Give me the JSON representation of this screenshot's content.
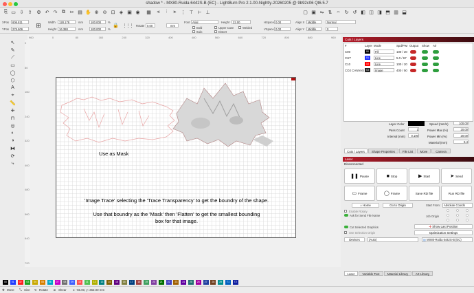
{
  "window": {
    "title": "shadow * - MX80-Ruida 6442S-B (EC) - LightBurn Pro 2.1.00-Nightly-20260205 @ 9b92c06 Qt6.5.7"
  },
  "toolbar2": {
    "xpos_label": "XPos",
    "xpos": "606.811",
    "ypos_label": "YPos",
    "ypos": "276.606",
    "width_label": "Width",
    "width": "128.178",
    "height_label": "Height",
    "height": "16.388",
    "scale_x": "100.000",
    "scale_y": "100.000",
    "unit_mm": "mm",
    "pct": "%",
    "rotate_label": "Rotate",
    "rotate": "0.00",
    "rotate_unit": "mm",
    "font_label": "Font",
    "font": "Arial",
    "height2_label": "Height",
    "text_height": "22.00",
    "hspace_label": "HSpace",
    "hspace": "0.00",
    "vspace_label": "VSpace",
    "vspace": "0.00",
    "align_x_label": "Align X",
    "align_x": "Middle",
    "align_y_label": "Align Y",
    "align_y": "Middle",
    "normal": "Normal",
    "offset": "0",
    "bold": "Bold",
    "italic": "Italic",
    "upper_case": "Upper Case",
    "welded": "Welded",
    "distort": "Distort"
  },
  "rulers": {
    "top": [
      "960",
      "0",
      "80",
      "160",
      "240",
      "320",
      "400",
      "480",
      "560",
      "640",
      "720",
      "800",
      "880",
      "960"
    ],
    "left": [
      "0",
      "80",
      "160",
      "240",
      "320",
      "400",
      "480",
      "560",
      "640",
      "720"
    ]
  },
  "canvas": {
    "note1": "Use as Mask",
    "note2": "'Image Trace' selecting the 'Trace Transparency' to get the boundry of the shape.",
    "note3a": "Use that boundry as the 'Mask' then 'Flatten' to get the smallest bounding",
    "note3b": "box for that image."
  },
  "cuts": {
    "header": "Cuts / Layers",
    "cols": [
      "#",
      "Layer",
      "Mode",
      "Spd/Pwr",
      "Output",
      "Show",
      "Air"
    ],
    "rows": [
      {
        "name": "C00",
        "layer": "00",
        "mode": "Fill",
        "spd": "100 / 20",
        "color": "#000000"
      },
      {
        "name": "CUT",
        "layer": "01",
        "mode": "Line",
        "spd": "5.0 / 67",
        "color": "#2233ff"
      },
      {
        "name": "C10",
        "layer": "10",
        "mode": "Line",
        "spd": "100 / 20",
        "color": "#ff0000"
      },
      {
        "name": "CO2 CANVAS",
        "layer": "T2",
        "mode": "Image",
        "spd": "400 / 50",
        "color": "#222222"
      }
    ],
    "layer_color": "Layer Color",
    "speed_label": "Speed (mm/s)",
    "speed": "100.00",
    "pass_label": "Pass Count",
    "pass": "1",
    "pmax_label": "Power Max (%)",
    "pmax": "20.00",
    "interval_label": "Interval (mm)",
    "interval": "0.100",
    "pmin_label": "Power Min (%)",
    "pmin": "20.00",
    "material_label": "Material (mm)",
    "material": "6.4"
  },
  "tabs1": [
    "Cuts / Layers",
    "Shape Properties",
    "File List",
    "Move",
    "Camera"
  ],
  "laser": {
    "header": "Laser",
    "status": "Disconnected",
    "pause": "Pause",
    "stop": "Stop",
    "start": "Start",
    "send": "Send",
    "frame1": "Frame",
    "frame2": "Frame",
    "save_rd": "Save RD file",
    "run_rd": "Run RD file",
    "home": "Home",
    "go_origin": "Go to Origin",
    "start_from_label": "Start From:",
    "start_from": "Absolute Coords",
    "enable_rotary": "Enable Rotary",
    "ask_send": "Ask for Send File Name",
    "job_origin": "Job Origin",
    "cut_selected": "Cut Selected Graphics",
    "use_selection": "Use Selection Origin",
    "show_last": "Show Last Position",
    "optimization": "Optimization Settings",
    "devices": "Devices",
    "auto": "(Auto)",
    "device": "MX80-Ruida 6442S-B (EC)"
  },
  "tabs2": [
    "Laser",
    "Variable Text",
    "Material Library",
    "Art Library"
  ],
  "palette": [
    {
      "t": "00",
      "c": "#000000"
    },
    {
      "t": "01",
      "c": "#1f3cff"
    },
    {
      "t": "02",
      "c": "#ff1f1f"
    },
    {
      "t": "03",
      "c": "#1fa31f"
    },
    {
      "t": "04",
      "c": "#c8a800"
    },
    {
      "t": "05",
      "c": "#d88000"
    },
    {
      "t": "06",
      "c": "#00a5c8"
    },
    {
      "t": "07",
      "c": "#c800c8"
    },
    {
      "t": "08",
      "c": "#707070"
    },
    {
      "t": "09",
      "c": "#4060ff"
    },
    {
      "t": "10",
      "c": "#ff5050"
    },
    {
      "t": "11",
      "c": "#50c050"
    },
    {
      "t": "12",
      "c": "#b0b000"
    },
    {
      "t": "13",
      "c": "#008080"
    },
    {
      "t": "14",
      "c": "#806000"
    },
    {
      "t": "15",
      "c": "#600080"
    },
    {
      "t": "16",
      "c": "#808040"
    },
    {
      "t": "17",
      "c": "#004080"
    },
    {
      "t": "18",
      "c": "#a04040"
    },
    {
      "t": "19",
      "c": "#40a060"
    },
    {
      "t": "20",
      "c": "#8040a0"
    },
    {
      "t": "21",
      "c": "#007000"
    },
    {
      "t": "22",
      "c": "#4040c0"
    },
    {
      "t": "23",
      "c": "#a06000"
    },
    {
      "t": "24",
      "c": "#6000a0"
    },
    {
      "t": "25",
      "c": "#207070"
    },
    {
      "t": "26",
      "c": "#a000a0"
    },
    {
      "t": "27",
      "c": "#2040a0"
    },
    {
      "t": "28",
      "c": "#704020"
    },
    {
      "t": "29",
      "c": "#009090"
    },
    {
      "t": "T1",
      "c": "#0060c0"
    },
    {
      "t": "T2",
      "c": "#1020a0"
    }
  ],
  "status": {
    "move": "Move",
    "size": "Size",
    "rotate": "Rotate",
    "shear": "Shear",
    "coords": "x: -65.00, y: 363.00 mm"
  }
}
